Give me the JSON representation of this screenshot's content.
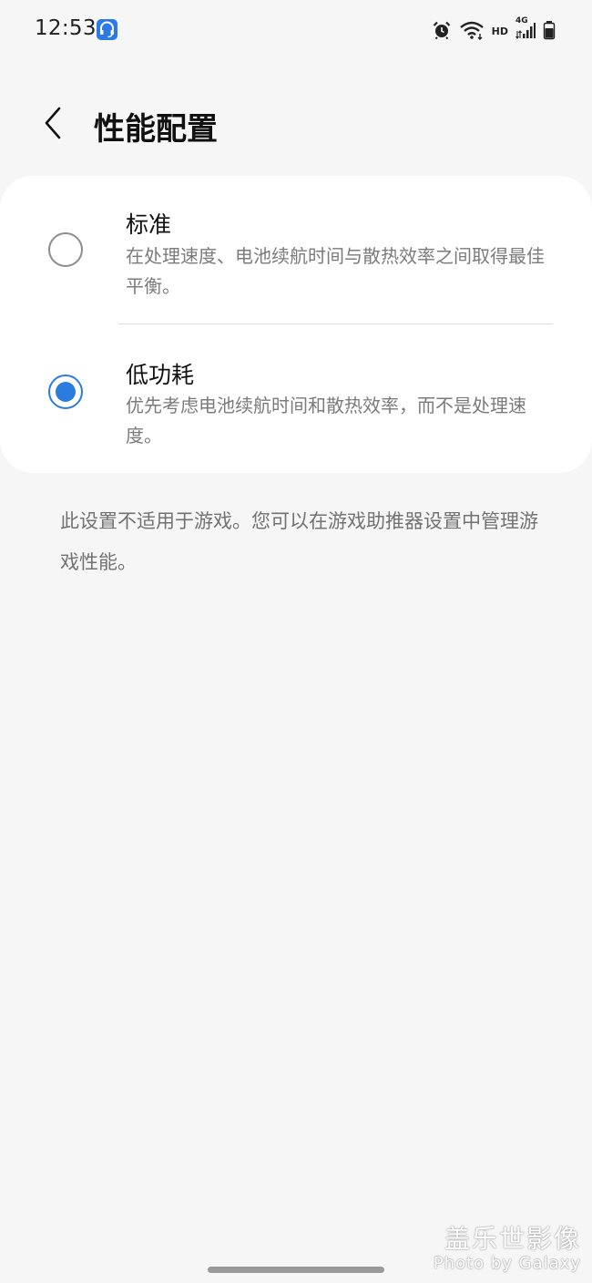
{
  "status_bar": {
    "time": "12:53",
    "app_icon": "headset-icon",
    "icons": [
      "alarm-clock-icon",
      "wifi-icon",
      "hd-icon",
      "4g-signal-icon",
      "battery-icon"
    ],
    "hd_label": "HD",
    "network_label": "4G"
  },
  "header": {
    "back_icon": "chevron-left-icon",
    "title": "性能配置"
  },
  "options": [
    {
      "title": "标准",
      "description": "在处理速度、电池续航时间与散热效率之间取得最佳平衡。",
      "selected": false
    },
    {
      "title": "低功耗",
      "description": "优先考虑电池续航时间和散热效率，而不是处理速度。",
      "selected": true
    }
  ],
  "footnote": "此设置不适用于游戏。您可以在游戏助推器设置中管理游戏性能。",
  "watermark": {
    "cn": "盖乐世影像",
    "en": "Photo by Galaxy"
  },
  "colors": {
    "accent": "#2a7ddf",
    "background": "#f6f6f6",
    "card": "#ffffff",
    "secondary_text": "#7b7b7b"
  }
}
